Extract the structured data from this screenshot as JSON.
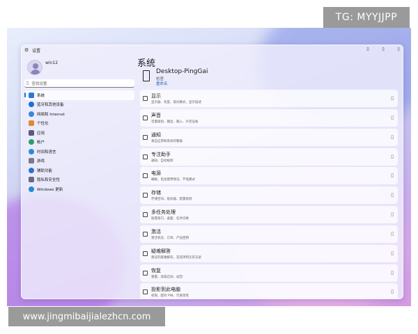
{
  "watermark_top": "TG: MYYJJPP",
  "watermark_bottom": "www.jingmibaijialezhcn.com",
  "window": {
    "title": "设置",
    "controls": [
      "minimize",
      "maximize",
      "close"
    ]
  },
  "sidebar": {
    "username": "win12",
    "search_placeholder": "查找设置",
    "items": [
      {
        "label": "系统",
        "icon": "monitor-icon",
        "color": "#2b7bd6",
        "active": true
      },
      {
        "label": "蓝牙和其他设备",
        "icon": "bluetooth-icon",
        "color": "#1f6fd0",
        "active": false
      },
      {
        "label": "网络和 Internet",
        "icon": "network-icon",
        "color": "#3a86d8",
        "active": false
      },
      {
        "label": "个性化",
        "icon": "brush-icon",
        "color": "#e08a30",
        "active": false
      },
      {
        "label": "应用",
        "icon": "apps-icon",
        "color": "#5a5a7a",
        "active": false
      },
      {
        "label": "帐户",
        "icon": "account-icon",
        "color": "#2f9e6a",
        "active": false
      },
      {
        "label": "时间和语言",
        "icon": "globe-clock-icon",
        "color": "#2a8bd8",
        "active": false
      },
      {
        "label": "游戏",
        "icon": "gamepad-icon",
        "color": "#7a7a8a",
        "active": false
      },
      {
        "label": "辅助功能",
        "icon": "accessibility-icon",
        "color": "#2a72d0",
        "active": false
      },
      {
        "label": "隐私和安全性",
        "icon": "shield-icon",
        "color": "#6a6a7e",
        "active": false
      },
      {
        "label": "Windows 更新",
        "icon": "update-icon",
        "color": "#2a86d8",
        "active": false
      }
    ]
  },
  "content": {
    "page_title": "系统",
    "device_name": "Desktop-PingGai",
    "device_subtitle": "检查",
    "rename_link": "重命名",
    "cards": [
      {
        "title": "显示",
        "desc": "显示器、亮度、夜间模式、显示描述"
      },
      {
        "title": "声音",
        "desc": "音量级别、输出、输入、声音设备"
      },
      {
        "title": "通知",
        "desc": "来自应用和系统的警报"
      },
      {
        "title": "专注助手",
        "desc": "通知、自动规则"
      },
      {
        "title": "电源",
        "desc": "睡眠、电池使用情况、节电模式"
      },
      {
        "title": "存储",
        "desc": "存储空间、驱动器、配置规则"
      },
      {
        "title": "多任务处理",
        "desc": "贴靠窗口、桌面、任务切换"
      },
      {
        "title": "激活",
        "desc": "激活状态、订阅、产品密钥"
      },
      {
        "title": "疑难解答",
        "desc": "建议的疑难解答、首选项和历史记录"
      },
      {
        "title": "恢复",
        "desc": "重置、高级启动、返回"
      },
      {
        "title": "投影到此电脑",
        "desc": "权限、配对 PIN、可发现性"
      }
    ]
  }
}
